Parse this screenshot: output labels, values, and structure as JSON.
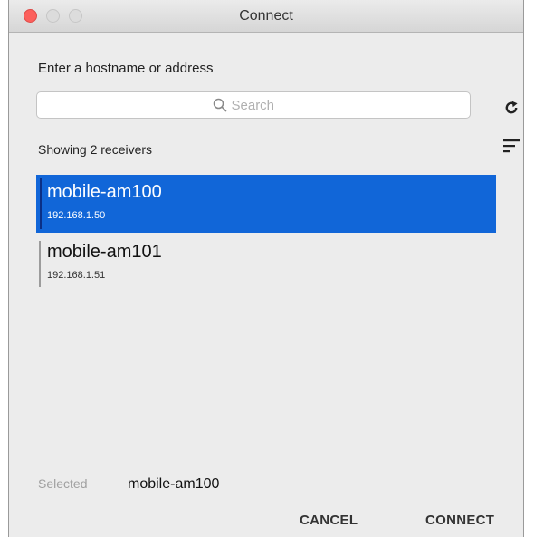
{
  "window": {
    "title": "Connect"
  },
  "prompt": "Enter a hostname or address",
  "search": {
    "placeholder": "Search",
    "value": ""
  },
  "icons": {
    "search": "magnifier-icon",
    "refresh": "refresh-icon",
    "sort": "sort-icon"
  },
  "list": {
    "count_text": "Showing 2 receivers",
    "items": [
      {
        "name": "mobile-am100",
        "address": "192.168.1.50",
        "selected": true
      },
      {
        "name": "mobile-am101",
        "address": "192.168.1.51",
        "selected": false
      }
    ]
  },
  "selection": {
    "label": "Selected",
    "value": "mobile-am100"
  },
  "buttons": {
    "cancel": "CANCEL",
    "connect": "CONNECT"
  },
  "colors": {
    "selected_row": "#1166d8",
    "close_button": "#fc605c",
    "window_bg": "#ececec"
  }
}
